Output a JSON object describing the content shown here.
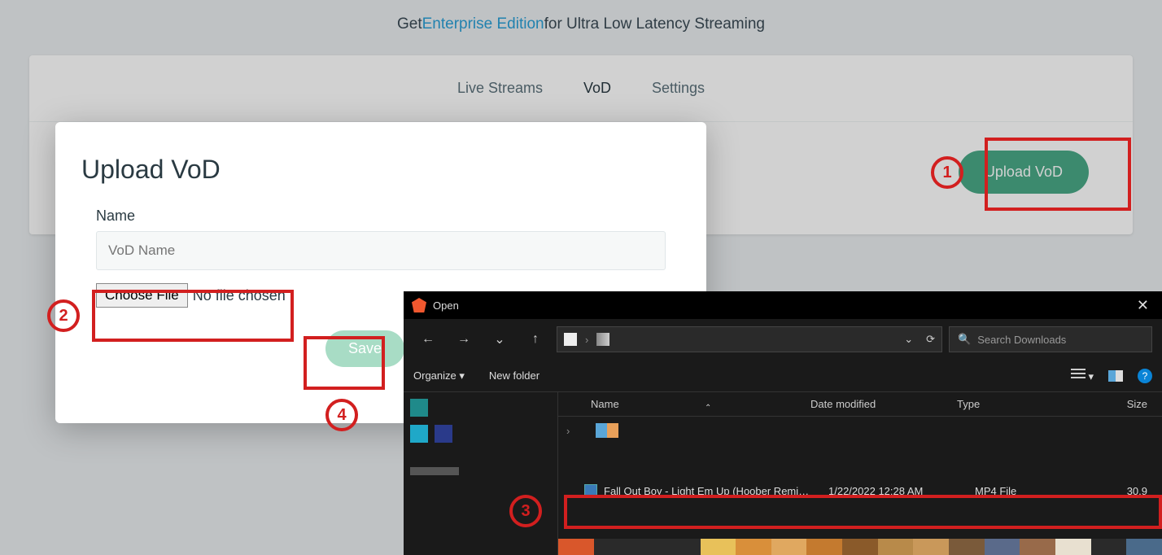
{
  "banner": {
    "pre": "Get ",
    "link": "Enterprise Edition",
    "post": " for Ultra Low Latency Streaming"
  },
  "tabs": {
    "live": "Live Streams",
    "vod": "VoD",
    "settings": "Settings",
    "active": "vod"
  },
  "uploadButton": "Upload VoD",
  "modal": {
    "title": "Upload VoD",
    "nameLabel": "Name",
    "namePlaceholder": "VoD Name",
    "chooseFile": "Choose File",
    "fileStatus": "No file chosen",
    "save": "Save"
  },
  "fileDialog": {
    "title": "Open",
    "searchPlaceholder": "Search Downloads",
    "organize": "Organize",
    "newFolder": "New folder",
    "columns": {
      "name": "Name",
      "date": "Date modified",
      "type": "Type",
      "size": "Size"
    },
    "rows": [
      {
        "name": "Fall Out Boy - Light Em Up (Hoober Remi…",
        "date": "1/22/2022 12:28 AM",
        "type": "MP4 File",
        "size": "30,9"
      }
    ]
  },
  "annotations": {
    "n1": "1",
    "n2": "2",
    "n3": "3",
    "n4": "4"
  },
  "colorstrip": [
    "#d9572b",
    "#2a2a2a",
    "#2a2a2a",
    "#2a2a2a",
    "#e8c15a",
    "#d98f3a",
    "#e0a860",
    "#c47a2f",
    "#8a5a2a",
    "#b88a4a",
    "#c9985a",
    "#7a5a3a",
    "#5a6a8a",
    "#986a4a",
    "#e8e0d0",
    "#2a2a2a",
    "#4a6a8a"
  ]
}
